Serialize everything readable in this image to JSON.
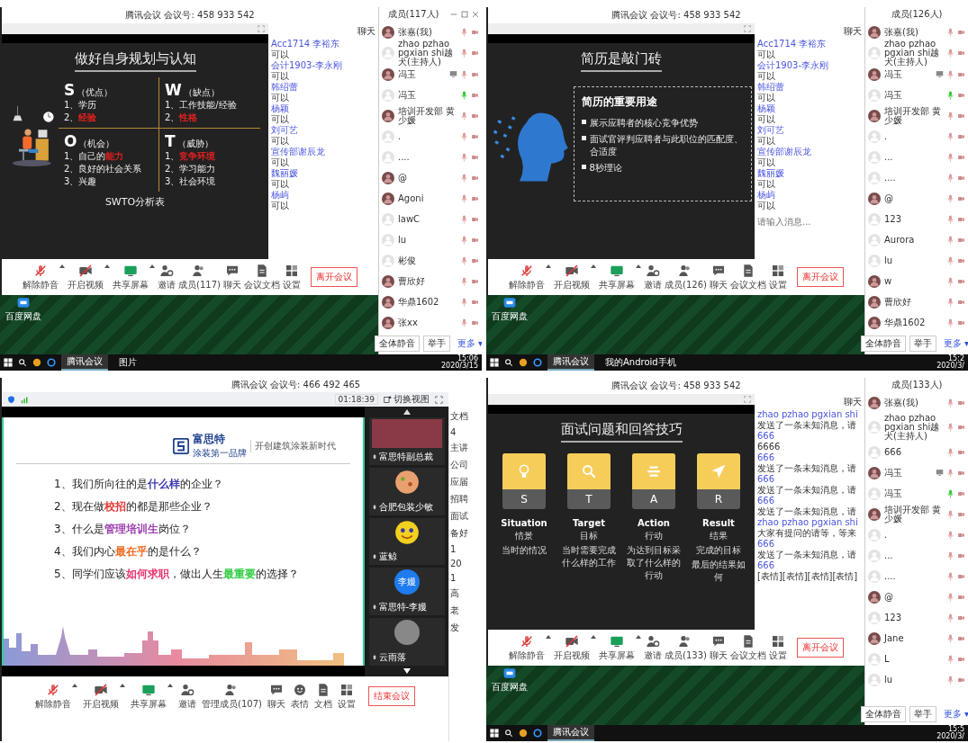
{
  "screens": [
    {
      "kind": "member_view",
      "meeting_title": "腾讯会议 会议号: 458 933 542",
      "slide": {
        "kind": "swot",
        "title": "做好自身规划与认知",
        "footer": "SWTO分析表",
        "quadrants": [
          {
            "letter": "S",
            "label": "（优点）",
            "items": [
              [
                {
                  "text": "1、学历"
                }
              ],
              [
                {
                  "text": "2、"
                },
                {
                  "text": "经验",
                  "color": "#e02020"
                }
              ]
            ]
          },
          {
            "letter": "W",
            "label": "（缺点）",
            "items": [
              [
                {
                  "text": "1、工作技能/经验"
                }
              ],
              [
                {
                  "text": "2、"
                },
                {
                  "text": "性格",
                  "color": "#e02020"
                }
              ]
            ]
          },
          {
            "letter": "O",
            "label": "（机会）",
            "items": [
              [
                {
                  "text": "1、自己的"
                },
                {
                  "text": "能力",
                  "color": "#e02020"
                }
              ],
              [
                {
                  "text": "2、良好的社会关系"
                }
              ],
              [
                {
                  "text": "3、兴趣"
                }
              ]
            ]
          },
          {
            "letter": "T",
            "label": "（威胁）",
            "items": [
              [
                {
                  "text": "1、"
                },
                {
                  "text": "竞争环境",
                  "color": "#e02020"
                }
              ],
              [
                {
                  "text": "2、学习能力"
                }
              ],
              [
                {
                  "text": "3、社会环境"
                }
              ]
            ]
          }
        ]
      },
      "chat": {
        "title": "聊天",
        "messages": [
          {
            "sender": "Acc1714 李裕东",
            "text": "可以"
          },
          {
            "sender": "会计1903-李永刚",
            "text": "可以"
          },
          {
            "sender": "韩绍蕾",
            "text": "可以"
          },
          {
            "sender": "杨颖",
            "text": "可以"
          },
          {
            "sender": "刘可艺",
            "text": "可以"
          },
          {
            "sender": "宣传部谢辰龙",
            "text": "可以"
          },
          {
            "sender": "魏丽媛",
            "text": "可以"
          },
          {
            "sender": "杨屿",
            "text": "可以"
          }
        ]
      },
      "toolbar": [
        {
          "kind": "mic",
          "label": "解除静音"
        },
        {
          "kind": "video",
          "label": "开启视频"
        },
        {
          "kind": "share",
          "label": "共享屏幕"
        },
        {
          "kind": "invite",
          "label": "邀请"
        },
        {
          "kind": "members",
          "label": "成员(117)"
        },
        {
          "kind": "chat",
          "label": "聊天"
        },
        {
          "kind": "doc",
          "label": "会议文档"
        },
        {
          "kind": "settings",
          "label": "设置"
        }
      ],
      "leave_button": "离开会议",
      "desktop_icon_label": "百度网盘",
      "members": {
        "title": "成员(117人)",
        "window_controls": true,
        "items": [
          {
            "name": "张嘉(我)",
            "kind": "photo",
            "mic_on": false,
            "sharing": false
          },
          {
            "name": "zhao pzhao pgxian shi越犬(主持人)",
            "kind": "default",
            "mic_on": false,
            "sharing": false
          },
          {
            "name": "冯玉",
            "kind": "photo",
            "mic_on": false,
            "sharing": true
          },
          {
            "name": "冯玉",
            "kind": "default",
            "mic_on": true,
            "sharing": false
          },
          {
            "name": "培训开发部 黄少媛",
            "kind": "photo",
            "mic_on": false,
            "sharing": false
          },
          {
            "name": ".",
            "kind": "default",
            "mic_on": false,
            "sharing": false
          },
          {
            "name": "....",
            "kind": "default",
            "mic_on": false,
            "sharing": false
          },
          {
            "name": "@",
            "kind": "photo",
            "mic_on": false,
            "sharing": false
          },
          {
            "name": "Agoni",
            "kind": "photo",
            "mic_on": false,
            "sharing": false
          },
          {
            "name": "lawC",
            "kind": "default",
            "mic_on": false,
            "sharing": false
          },
          {
            "name": "lu",
            "kind": "default",
            "mic_on": false,
            "sharing": false
          },
          {
            "name": "彬俊",
            "kind": "default",
            "mic_on": false,
            "sharing": false
          },
          {
            "name": "曹欣好",
            "kind": "photo",
            "mic_on": false,
            "sharing": false
          },
          {
            "name": "华鼎1602",
            "kind": "photo",
            "mic_on": false,
            "sharing": false
          },
          {
            "name": "张xx",
            "kind": "photo",
            "mic_on": false,
            "sharing": false
          }
        ],
        "buttons": [
          "全体静音",
          "举手",
          "更多 ▾"
        ]
      },
      "taskbar": {
        "apps": [
          {
            "label": "腾讯会议",
            "selected": true
          },
          {
            "label": "图片",
            "selected": false
          }
        ],
        "time": "15:06",
        "date": "2020/3/15"
      }
    },
    {
      "kind": "member_view",
      "meeting_title": "腾讯会议 会议号: 458 933 542",
      "slide": {
        "kind": "resume",
        "title": "简历是敲门砖",
        "box_title": "简历的重要用途",
        "bullets": [
          "展示应聘者的核心竞争优势",
          "面试官评判应聘者与此职位的匹配度、合适度",
          "8秒理论"
        ]
      },
      "chat": {
        "title": "聊天",
        "input_placeholder": "请输入消息...",
        "messages": [
          {
            "sender": "Acc1714 李裕东",
            "text": "可以"
          },
          {
            "sender": "会计1903-李永刚",
            "text": "可以"
          },
          {
            "sender": "韩绍蕾",
            "text": "可以"
          },
          {
            "sender": "杨颖",
            "text": "可以"
          },
          {
            "sender": "刘可艺",
            "text": "可以"
          },
          {
            "sender": "宣传部谢辰龙",
            "text": "可以"
          },
          {
            "sender": "魏丽媛",
            "text": "可以"
          },
          {
            "sender": "杨屿",
            "text": "可以"
          }
        ]
      },
      "toolbar": [
        {
          "kind": "mic",
          "label": "解除静音"
        },
        {
          "kind": "video",
          "label": "开启视频"
        },
        {
          "kind": "share",
          "label": "共享屏幕"
        },
        {
          "kind": "invite",
          "label": "邀请"
        },
        {
          "kind": "members",
          "label": "成员(126)"
        },
        {
          "kind": "chat",
          "label": "聊天"
        },
        {
          "kind": "doc",
          "label": "会议文档"
        },
        {
          "kind": "settings",
          "label": "设置"
        }
      ],
      "leave_button": "离开会议",
      "desktop_icon_label": "百度网盘",
      "members": {
        "title": "成员(126人)",
        "window_controls": false,
        "items": [
          {
            "name": "张嘉(我)",
            "kind": "photo",
            "mic_on": false,
            "sharing": false
          },
          {
            "name": "zhao pzhao pgxian shi越犬(主持人)",
            "kind": "default",
            "mic_on": false,
            "sharing": false
          },
          {
            "name": "冯玉",
            "kind": "photo",
            "mic_on": false,
            "sharing": true
          },
          {
            "name": "冯玉",
            "kind": "default",
            "mic_on": true,
            "sharing": false
          },
          {
            "name": "培训开发部 黄少媛",
            "kind": "photo",
            "mic_on": false,
            "sharing": false
          },
          {
            "name": ".",
            "kind": "default",
            "mic_on": false,
            "sharing": false
          },
          {
            "name": "...",
            "kind": "default",
            "mic_on": false,
            "sharing": false
          },
          {
            "name": "....",
            "kind": "default",
            "mic_on": false,
            "sharing": false
          },
          {
            "name": "@",
            "kind": "photo",
            "mic_on": false,
            "sharing": false
          },
          {
            "name": "123",
            "kind": "default",
            "mic_on": false,
            "sharing": false
          },
          {
            "name": "Aurora",
            "kind": "default",
            "mic_on": false,
            "sharing": false
          },
          {
            "name": "lu",
            "kind": "default",
            "mic_on": false,
            "sharing": false
          },
          {
            "name": "w",
            "kind": "photo",
            "mic_on": false,
            "sharing": false
          },
          {
            "name": "曹欣好",
            "kind": "photo",
            "mic_on": false,
            "sharing": false
          },
          {
            "name": "华鼎1602",
            "kind": "photo",
            "mic_on": false,
            "sharing": false
          }
        ],
        "buttons": [
          "全体静音",
          "举手",
          "更多 ▾"
        ]
      },
      "taskbar": {
        "apps": [
          {
            "label": "腾讯会议",
            "selected": true
          },
          {
            "label": "我的Android手机",
            "selected": false
          }
        ],
        "time": "15:2",
        "date": "2020/3/"
      }
    },
    {
      "kind": "gallery_view",
      "meeting_title": "腾讯会议 会议号: 466 492 465",
      "timer": "01:18:39",
      "switch_view": "切换视图",
      "slide": {
        "kind": "questions",
        "logo": "富思特",
        "logo_sub": "涂装第一品牌",
        "slogan": "开创建筑涂装新时代",
        "questions": [
          [
            {
              "text": "1、我们所向往的是"
            },
            {
              "text": "什么样",
              "color": "#3b3bb0"
            },
            {
              "text": "的企业？"
            }
          ],
          [
            {
              "text": "2、现在做"
            },
            {
              "text": "校招",
              "color": "#e53935"
            },
            {
              "text": "的都是那些企业？"
            }
          ],
          [
            {
              "text": "3、什么是"
            },
            {
              "text": "管理培训生",
              "color": "#9b3fb0"
            },
            {
              "text": "岗位？"
            }
          ],
          [
            {
              "text": "4、我们内心"
            },
            {
              "text": "最在乎",
              "color": "#f06a20"
            },
            {
              "text": "的是什么？"
            }
          ],
          [
            {
              "text": "5、同学们应该"
            },
            {
              "text": "如何求职",
              "color": "#e8336d"
            },
            {
              "text": "，做出人生"
            },
            {
              "text": "最重要",
              "color": "#2ecc40"
            },
            {
              "text": "的选择？"
            }
          ]
        ]
      },
      "videos": [
        {
          "name": "富思特副总裁",
          "kind": "photo"
        },
        {
          "name": "合肥包装少敏",
          "kind": "cookie"
        },
        {
          "name": "蓝鲸",
          "kind": "smiley"
        },
        {
          "name": "富思特-李嫚",
          "kind": "text",
          "avatar_text": "李嫚"
        },
        {
          "name": "云雨落",
          "kind": "photo_round"
        }
      ],
      "side_texts": [
        "文档",
        "4",
        "主讲",
        "公司",
        "应届",
        "招聘",
        "面试",
        "备好",
        "1",
        "20",
        "1",
        "高",
        "老",
        "发"
      ],
      "toolbar": [
        {
          "kind": "mic",
          "label": "解除静音"
        },
        {
          "kind": "video",
          "label": "开启视频"
        },
        {
          "kind": "share",
          "label": "共享屏幕"
        },
        {
          "kind": "invite",
          "label": "邀请"
        },
        {
          "kind": "members",
          "label": "管理成员(107)"
        },
        {
          "kind": "chat",
          "label": "聊天"
        },
        {
          "kind": "emoji",
          "label": "表情"
        },
        {
          "kind": "doc",
          "label": "文档"
        },
        {
          "kind": "settings",
          "label": "设置"
        }
      ],
      "leave_button": "结束会议"
    },
    {
      "kind": "member_view",
      "meeting_title": "腾讯会议 会议号: 458 933 542",
      "slide": {
        "kind": "star",
        "title": "面试问题和回答技巧",
        "cards": [
          {
            "letter": "S",
            "title": "Situation",
            "lines": [
              "情景",
              "当时的情况"
            ]
          },
          {
            "letter": "T",
            "title": "Target",
            "lines": [
              "目标",
              "当时需要完成什么样的工作"
            ]
          },
          {
            "letter": "A",
            "title": "Action",
            "lines": [
              "行动",
              "为达到目标采取了什么样的行动"
            ]
          },
          {
            "letter": "R",
            "title": "Result",
            "lines": [
              "结果",
              "完成的目标",
              "最后的结果如何"
            ]
          }
        ]
      },
      "chat": {
        "title": "聊天",
        "messages": [
          {
            "sender": "zhao pzhao pgxian shi",
            "text": "发送了一条未知消息，请"
          },
          {
            "sender": "666",
            "text": "6666"
          },
          {
            "sender": "666",
            "text": "发送了一条未知消息，请"
          },
          {
            "sender": "666",
            "text": "发送了一条未知消息，请"
          },
          {
            "sender": "666",
            "text": "发送了一条未知消息，请"
          },
          {
            "sender": "zhao pzhao pgxian shi",
            "text": "大家有提问的请等，等来"
          },
          {
            "sender": "666",
            "text": "发送了一条未知消息，请"
          },
          {
            "sender": "666",
            "text": "[表情][表情][表情][表情]"
          }
        ]
      },
      "toolbar": [
        {
          "kind": "mic",
          "label": "解除静音"
        },
        {
          "kind": "video",
          "label": "开启视频"
        },
        {
          "kind": "share",
          "label": "共享屏幕"
        },
        {
          "kind": "invite",
          "label": "邀请"
        },
        {
          "kind": "members",
          "label": "成员(133)"
        },
        {
          "kind": "chat",
          "label": "聊天"
        },
        {
          "kind": "doc",
          "label": "会议文档"
        },
        {
          "kind": "settings",
          "label": "设置"
        }
      ],
      "leave_button": "离开会议",
      "desktop_icon_label": "百度网盘",
      "members": {
        "title": "成员(133人)",
        "window_controls": false,
        "items": [
          {
            "name": "张嘉(我)",
            "kind": "photo",
            "mic_on": false,
            "sharing": false
          },
          {
            "name": "zhao pzhao pgxian shi越犬(主持人)",
            "kind": "default",
            "mic_on": false,
            "sharing": false
          },
          {
            "name": "666",
            "kind": "default",
            "mic_on": false,
            "sharing": false
          },
          {
            "name": "冯玉",
            "kind": "photo",
            "mic_on": false,
            "sharing": true
          },
          {
            "name": "冯玉",
            "kind": "default",
            "mic_on": true,
            "sharing": false
          },
          {
            "name": "培训开发部 黄少媛",
            "kind": "photo",
            "mic_on": false,
            "sharing": false
          },
          {
            "name": ".",
            "kind": "default",
            "mic_on": false,
            "sharing": false
          },
          {
            "name": "...",
            "kind": "default",
            "mic_on": false,
            "sharing": false
          },
          {
            "name": "....",
            "kind": "default",
            "mic_on": false,
            "sharing": false
          },
          {
            "name": "@",
            "kind": "photo",
            "mic_on": false,
            "sharing": false
          },
          {
            "name": "123",
            "kind": "default",
            "mic_on": false,
            "sharing": false
          },
          {
            "name": "Jane",
            "kind": "photo",
            "mic_on": false,
            "sharing": false
          },
          {
            "name": "L",
            "kind": "default",
            "mic_on": false,
            "sharing": false
          },
          {
            "name": "lu",
            "kind": "default",
            "mic_on": false,
            "sharing": false
          }
        ],
        "buttons": [
          "全体静音",
          "举手",
          "更多 ▾"
        ]
      },
      "taskbar": {
        "apps": [
          {
            "label": "腾讯会议",
            "selected": true
          }
        ],
        "time": "15:5",
        "date": "2020/3/"
      }
    }
  ]
}
